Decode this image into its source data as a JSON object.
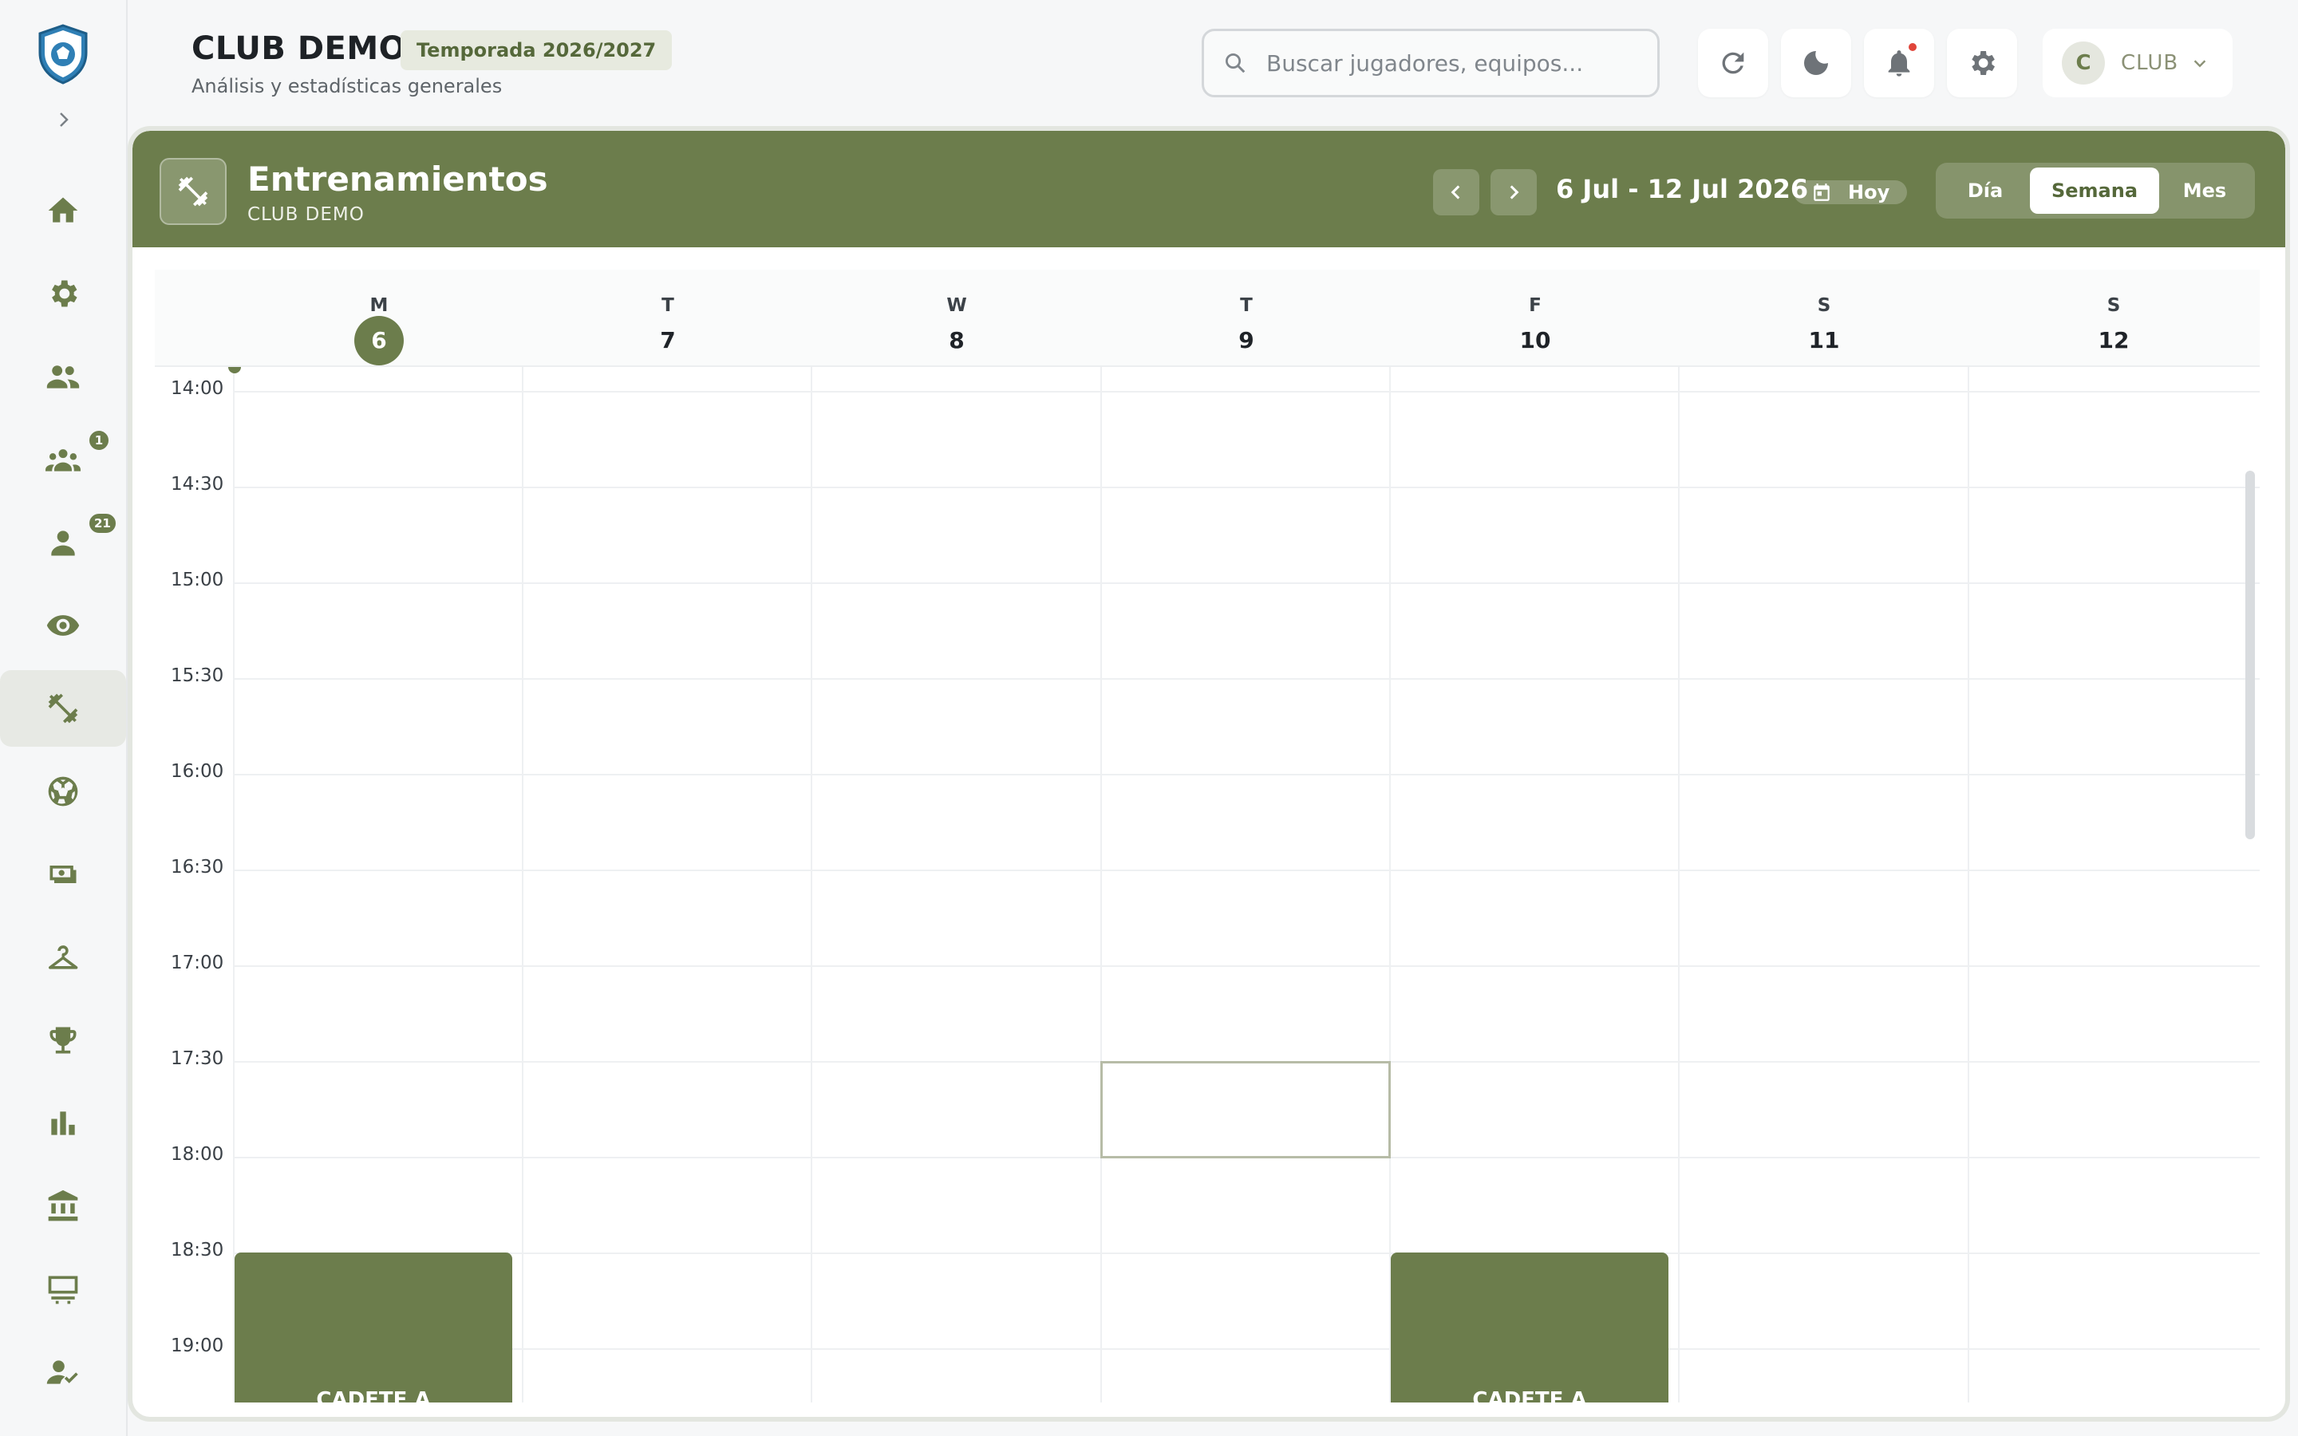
{
  "header": {
    "title": "CLUB DEMO",
    "season": "Temporada 2026/2027",
    "subtitle": "Análisis y estadísticas generales",
    "search_placeholder": "Buscar jugadores, equipos...",
    "user_initial": "C",
    "user_label": "CLUB"
  },
  "sidebar": {
    "items": [
      {
        "icon": "home-icon"
      },
      {
        "icon": "gear-icon"
      },
      {
        "icon": "people-icon"
      },
      {
        "icon": "groups-icon",
        "badge": "1"
      },
      {
        "icon": "person-icon",
        "badge": "21"
      },
      {
        "icon": "eye-icon"
      },
      {
        "icon": "dumbbell-icon",
        "active": true
      },
      {
        "icon": "soccer-ball-icon"
      },
      {
        "icon": "money-icon"
      },
      {
        "icon": "hanger-icon"
      },
      {
        "icon": "trophy-icon"
      },
      {
        "icon": "bar-chart-icon"
      },
      {
        "icon": "bank-icon"
      },
      {
        "icon": "board-icon"
      },
      {
        "icon": "person-check-icon"
      }
    ]
  },
  "calendar": {
    "title": "Entrenamientos",
    "subtitle": "CLUB DEMO",
    "range": "6 Jul - 12 Jul 2026",
    "today_label": "Hoy",
    "views": {
      "day": "Día",
      "week": "Semana",
      "month": "Mes"
    },
    "active_view": "Semana",
    "days": [
      {
        "name": "M",
        "num": "6",
        "today": true
      },
      {
        "name": "T",
        "num": "7"
      },
      {
        "name": "W",
        "num": "8"
      },
      {
        "name": "T",
        "num": "9"
      },
      {
        "name": "F",
        "num": "10"
      },
      {
        "name": "S",
        "num": "11"
      },
      {
        "name": "S",
        "num": "12"
      }
    ],
    "times": [
      "14:00",
      "14:30",
      "15:00",
      "15:30",
      "16:00",
      "16:30",
      "17:00",
      "17:30",
      "18:00",
      "18:30",
      "19:00"
    ],
    "events": [
      {
        "day": 0,
        "label": "CADETE A"
      },
      {
        "day": 4,
        "label": "CADETE A"
      }
    ]
  },
  "colors": {
    "accent": "#6c7d4c",
    "notification": "#e0453a"
  }
}
